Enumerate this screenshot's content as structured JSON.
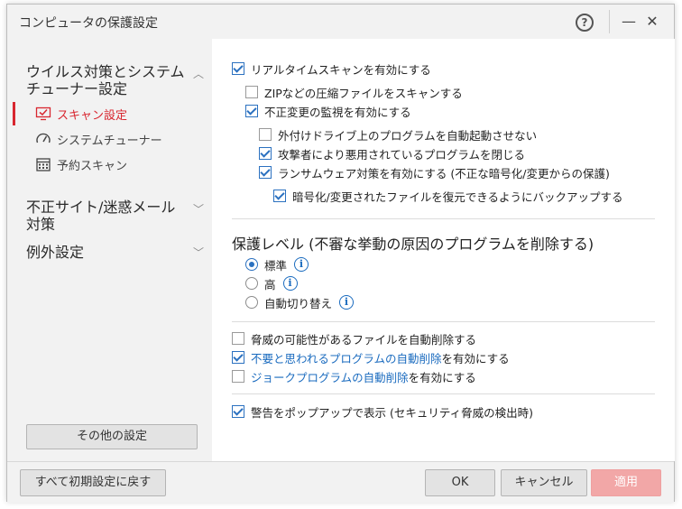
{
  "window": {
    "title": "コンピュータの保護設定",
    "help_glyph": "?",
    "minimize_glyph": "—",
    "close_glyph": "✕"
  },
  "sidebar": {
    "categories": [
      {
        "label_line1": "ウイルス対策とシステム",
        "label_line2": "チューナー設定",
        "expanded": true
      },
      {
        "label_line1": "不正サイト/迷惑メール",
        "label_line2": "対策",
        "expanded": false
      },
      {
        "label_line1": "例外設定",
        "expanded": false
      }
    ],
    "sub_items": [
      {
        "label": "スキャン設定",
        "icon": "monitor-check-icon",
        "active": true
      },
      {
        "label": "システムチューナー",
        "icon": "gauge-icon",
        "active": false
      },
      {
        "label": "予約スキャン",
        "icon": "calendar-icon",
        "active": false
      }
    ],
    "other_settings_label": "その他の設定"
  },
  "scan": {
    "realtime": "リアルタイムスキャンを有効にする",
    "zip": "ZIPなどの圧縮ファイルをスキャンする",
    "monitor_changes": "不正変更の監視を有効にする",
    "external_drive": "外付けドライブ上のプログラムを自動起動させない",
    "close_abused": "攻撃者により悪用されているプログラムを閉じる",
    "ransomware": "ランサムウェア対策を有効にする (不正な暗号化/変更からの保護)",
    "backup": "暗号化/変更されたファイルを復元できるようにバックアップする"
  },
  "protection_level": {
    "title": "保護レベル (不審な挙動の原因のプログラムを削除する)",
    "options": [
      {
        "label": "標準",
        "selected": true
      },
      {
        "label": "高",
        "selected": false
      },
      {
        "label": "自動切り替え",
        "selected": false
      }
    ],
    "info_glyph": "i"
  },
  "auto_delete": {
    "threat_files": "脅威の可能性があるファイルを自動削除する",
    "unwanted_link": "不要と思われるプログラムの自動削除",
    "unwanted_suffix": "を有効にする",
    "joke_link": "ジョークプログラムの自動削除",
    "joke_suffix": "を有効にする"
  },
  "popup": {
    "label": "警告をポップアップで表示 (セキュリティ脅威の検出時)"
  },
  "footer": {
    "reset_label": "すべて初期設定に戻す",
    "ok_label": "OK",
    "cancel_label": "キャンセル",
    "apply_label": "適用"
  },
  "colors": {
    "accent_red": "#d8262f",
    "link_blue": "#1a6bbf",
    "checkbox_blue": "#2b71c0",
    "apply_disabled": "#f2a7a7"
  }
}
